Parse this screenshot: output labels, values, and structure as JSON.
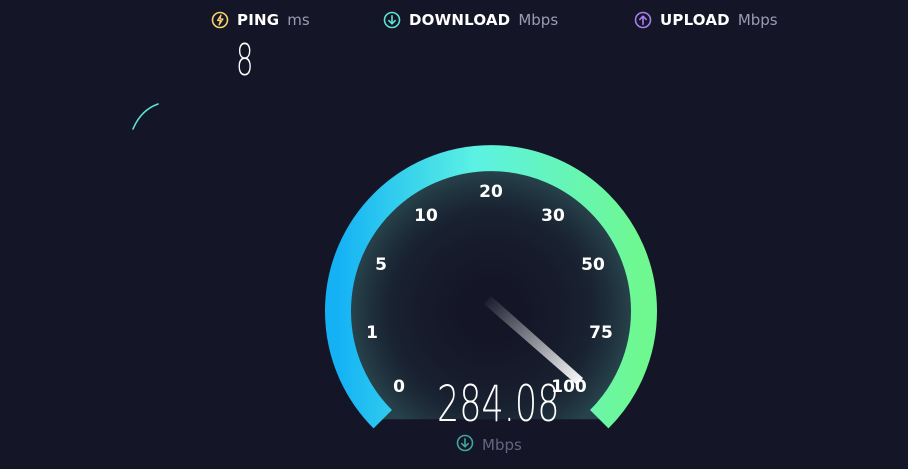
{
  "metrics": {
    "ping": {
      "label": "PING",
      "unit": "ms",
      "value": "8",
      "icon": "ping-icon",
      "color": "#f5d36b"
    },
    "download": {
      "label": "DOWNLOAD",
      "unit": "Mbps",
      "icon": "download-arrow-icon",
      "color": "#5ce1d3"
    },
    "upload": {
      "label": "UPLOAD",
      "unit": "Mbps",
      "icon": "upload-arrow-icon",
      "color": "#a97ff0"
    }
  },
  "gauge": {
    "ticks": [
      "0",
      "1",
      "5",
      "10",
      "20",
      "30",
      "50",
      "75",
      "100"
    ],
    "current_speed": "284.08",
    "unit": "Mbps",
    "gradient_colors": [
      "#14b2f5",
      "#5cf2e3",
      "#6ff88f"
    ]
  }
}
